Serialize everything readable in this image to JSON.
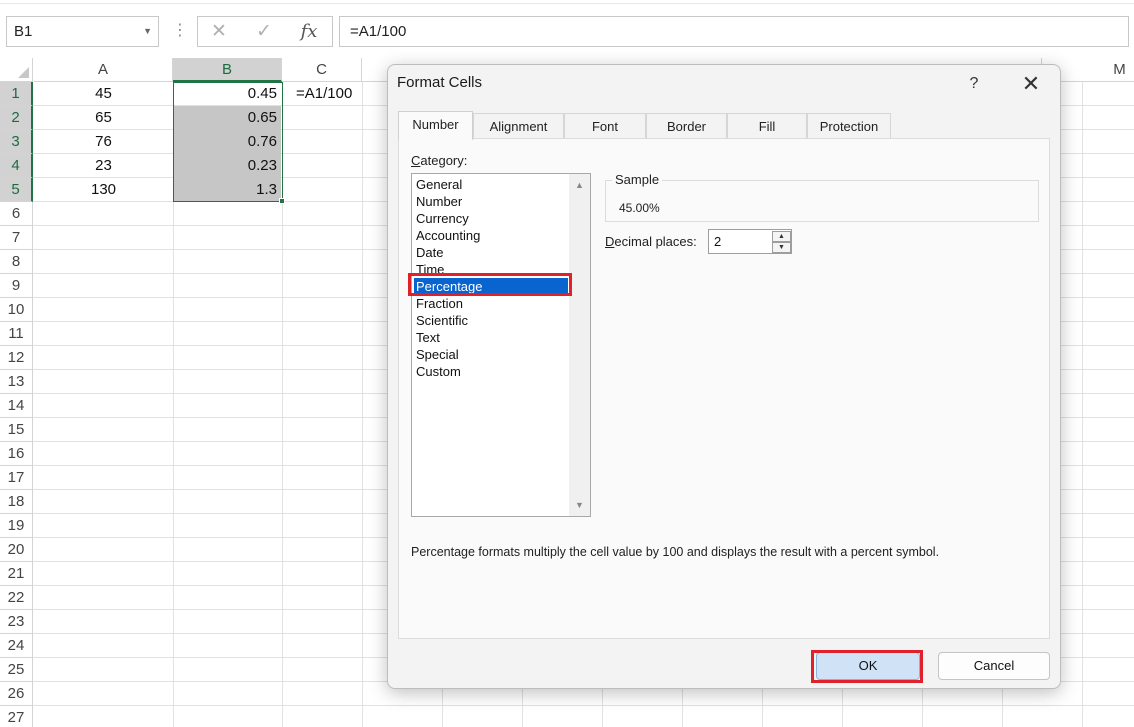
{
  "formula_bar": {
    "name_box": "B1",
    "cancel_icon": "close-icon",
    "enter_icon": "check-icon",
    "fx_label": "fx",
    "formula": "=A1/100"
  },
  "sheet": {
    "columns": [
      "A",
      "B",
      "C",
      "M"
    ],
    "selected_column": "B",
    "rows": [
      "1",
      "2",
      "3",
      "4",
      "5",
      "6",
      "7",
      "8",
      "9",
      "10",
      "11",
      "12",
      "13",
      "14",
      "15",
      "16",
      "17",
      "18",
      "19",
      "20",
      "21",
      "22",
      "23",
      "24",
      "25",
      "26",
      "27"
    ],
    "selected_rows": [
      "1",
      "2",
      "3",
      "4",
      "5"
    ],
    "column_a": [
      "45",
      "65",
      "76",
      "23",
      "130"
    ],
    "column_b": [
      "0.45",
      "0.65",
      "0.76",
      "0.23",
      "1.3"
    ],
    "c1": "=A1/100",
    "colors": {
      "selection_border": "#217346",
      "selection_fill": "#c6c6c6"
    }
  },
  "dialog": {
    "title": "Format Cells",
    "help_label": "?",
    "close_label": "✕",
    "tabs": [
      {
        "label": "Number",
        "active": true
      },
      {
        "label": "Alignment",
        "active": false
      },
      {
        "label": "Font",
        "active": false
      },
      {
        "label": "Border",
        "active": false
      },
      {
        "label": "Fill",
        "active": false
      },
      {
        "label": "Protection",
        "active": false
      }
    ],
    "category_label_first": "C",
    "category_label_rest": "ategory:",
    "categories": [
      "General",
      "Number",
      "Currency",
      "Accounting",
      "Date",
      "Time",
      "Percentage",
      "Fraction",
      "Scientific",
      "Text",
      "Special",
      "Custom"
    ],
    "selected_category": "Percentage",
    "sample_title": "Sample",
    "sample_value": "45.00%",
    "decimal_label_first": "D",
    "decimal_label_rest": "ecimal places:",
    "decimal_places": "2",
    "description": "Percentage formats multiply the cell value by 100 and displays the result with a percent symbol.",
    "ok_label": "OK",
    "cancel_label": "Cancel",
    "colors": {
      "highlight": "#e0202a",
      "selected_item": "#0a64d0"
    }
  }
}
